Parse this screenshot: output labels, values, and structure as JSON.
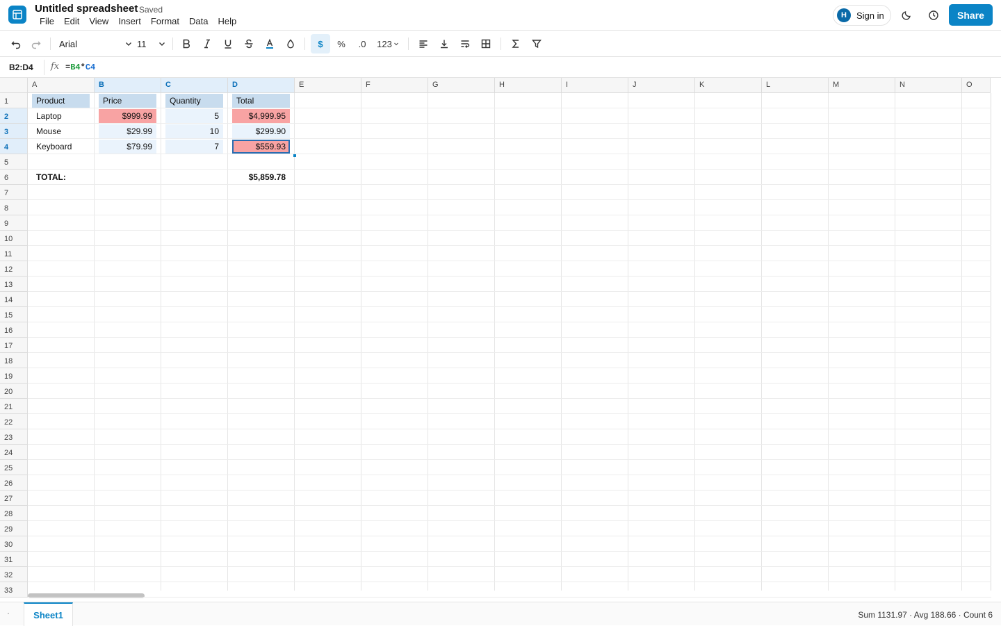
{
  "header": {
    "title": "Untitled spreadsheet",
    "save_status": "Saved",
    "menu": [
      "File",
      "Edit",
      "View",
      "Insert",
      "Format",
      "Data",
      "Help"
    ],
    "signin_avatar": "H",
    "signin_label": "Sign in",
    "share_label": "Share",
    "accent_color": "#0b84c6"
  },
  "toolbar": {
    "font_family": "Arial",
    "font_size": "11",
    "currency_label": "$",
    "percent_label": "%",
    "decimal_label": ".0",
    "number_format_label": "123",
    "icons": [
      "undo-icon",
      "redo-icon",
      "bold-icon",
      "italic-icon",
      "underline-icon",
      "strikethrough-icon",
      "text-color-icon",
      "fill-color-icon",
      "align-left-icon",
      "align-bottom-icon",
      "wrap-text-icon",
      "borders-icon",
      "sum-icon",
      "filter-icon"
    ]
  },
  "formula_bar": {
    "cell_ref": "B2:D4",
    "fx": "fx",
    "formula_eq": "=",
    "formula_ref1": "B4",
    "formula_op": "*",
    "formula_ref2": "C4"
  },
  "grid": {
    "columns": [
      "A",
      "B",
      "C",
      "D",
      "E",
      "F",
      "G",
      "H",
      "I",
      "J",
      "K",
      "L",
      "M",
      "N",
      "O"
    ],
    "selected_columns": [
      "B",
      "C",
      "D"
    ],
    "rows": [
      "1",
      "2",
      "3",
      "4",
      "5",
      "6",
      "7",
      "8",
      "9",
      "10",
      "11",
      "12",
      "13",
      "14",
      "15",
      "16",
      "17",
      "18",
      "19",
      "20",
      "21",
      "22",
      "23",
      "24",
      "25",
      "26",
      "27",
      "28",
      "29",
      "30",
      "31",
      "32",
      "33"
    ],
    "selected_rows": [
      "2",
      "3",
      "4"
    ],
    "cells": [
      {
        "ref": "A1",
        "value": "Product",
        "style": "hdr"
      },
      {
        "ref": "B1",
        "value": "Price",
        "style": "hdr"
      },
      {
        "ref": "C1",
        "value": "Quantity",
        "style": "hdr"
      },
      {
        "ref": "D1",
        "value": "Total",
        "style": "hdr"
      },
      {
        "ref": "A2",
        "value": "Laptop"
      },
      {
        "ref": "B2",
        "value": "$999.99",
        "align": "right",
        "style": "red"
      },
      {
        "ref": "C2",
        "value": "5",
        "align": "right",
        "style": "selbg"
      },
      {
        "ref": "D2",
        "value": "$4,999.95",
        "align": "right",
        "style": "red"
      },
      {
        "ref": "A3",
        "value": "Mouse"
      },
      {
        "ref": "B3",
        "value": "$29.99",
        "align": "right",
        "style": "selbg"
      },
      {
        "ref": "C3",
        "value": "10",
        "align": "right",
        "style": "selbg"
      },
      {
        "ref": "D3",
        "value": "$299.90",
        "align": "right",
        "style": "selbg"
      },
      {
        "ref": "A4",
        "value": "Keyboard"
      },
      {
        "ref": "B4",
        "value": "$79.99",
        "align": "right",
        "style": "selbg"
      },
      {
        "ref": "C4",
        "value": "7",
        "align": "right",
        "style": "selbg"
      },
      {
        "ref": "D4",
        "value": "$559.93",
        "align": "right",
        "style": "red",
        "active": true
      },
      {
        "ref": "A6",
        "value": "TOTAL:",
        "bold": true
      },
      {
        "ref": "D6",
        "value": "$5,859.78",
        "align": "right",
        "bold": true
      }
    ],
    "colors": {
      "header_fill": "#c8dcee",
      "selection_fill": "#eaf3fc",
      "highlight_red": "#f8a3a3"
    }
  },
  "bottom": {
    "sheet_tab": "Sheet1",
    "status": "Sum 1131.97 · Avg 188.66 · Count 6"
  }
}
